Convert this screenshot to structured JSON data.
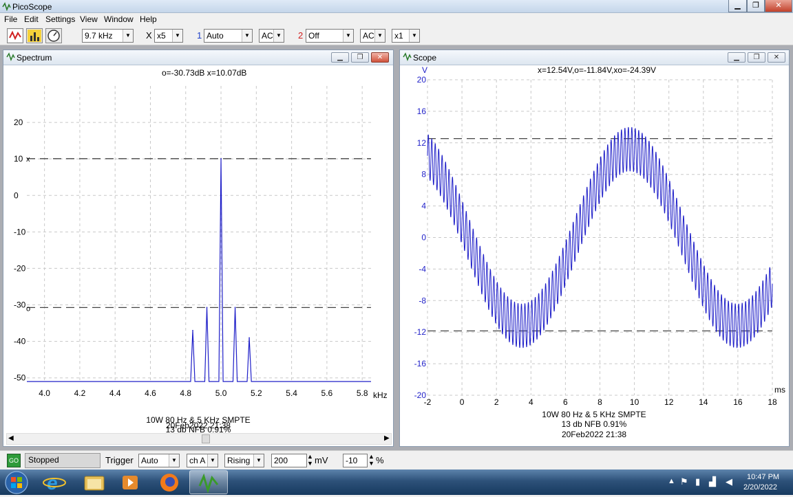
{
  "window": {
    "title": "PicoScope"
  },
  "menu": [
    "File",
    "Edit",
    "Settings",
    "View",
    "Window",
    "Help"
  ],
  "toolbar": {
    "timebase": "9.7 kHz",
    "mult_symbol": "X",
    "multiplier": "x5",
    "ch1_num": "1",
    "ch1_range": "Auto",
    "ch1_coupling": "AC",
    "ch2_num": "2",
    "ch2_range": "Off",
    "ch2_coupling": "AC",
    "ch2_mult": "x1"
  },
  "spectrum": {
    "title": "Spectrum",
    "readout": "o=-30.73dB  x=10.07dB",
    "xunit": "kHz",
    "caption": [
      "10W 80 Hz & 5 KHz SMPTE",
      "13 db NFB 0.91%",
      "20Feb2022  21:38"
    ],
    "marker_x": "x",
    "marker_o": "o"
  },
  "scope": {
    "title": "Scope",
    "yunit": "V",
    "readout": "x=12.54V,o=-11.84V,xo=-24.39V",
    "xunit": "ms",
    "caption": [
      "10W 80 Hz & 5 KHz SMPTE",
      "13 db NFB 0.91%",
      "20Feb2022  21:38"
    ]
  },
  "chart_data": [
    {
      "type": "line",
      "name": "spectrum",
      "xlabel": "kHz",
      "ylabel": "",
      "xlim": [
        3.9,
        5.85
      ],
      "ylim": [
        -51,
        30
      ],
      "xticks": [
        4.0,
        4.2,
        4.4,
        4.6,
        4.8,
        5.0,
        5.2,
        5.4,
        5.6,
        5.8
      ],
      "yticks": [
        20,
        10,
        0,
        -10,
        -20,
        -30,
        -40,
        -50
      ],
      "peaks": [
        {
          "x": 4.84,
          "y": -37
        },
        {
          "x": 4.92,
          "y": -30.7
        },
        {
          "x": 5.0,
          "y": 10.07
        },
        {
          "x": 5.08,
          "y": -30.7
        },
        {
          "x": 5.16,
          "y": -39
        }
      ],
      "floor": -51,
      "markers": {
        "x": 10.07,
        "o": -30.73
      },
      "color": "#1e1ec8"
    },
    {
      "type": "line",
      "name": "scope",
      "xlabel": "ms",
      "ylabel": "V",
      "xlim": [
        -2,
        18
      ],
      "ylim": [
        -20,
        20
      ],
      "xticks": [
        -2,
        0,
        2,
        4,
        6,
        8,
        10,
        12,
        14,
        16,
        18
      ],
      "yticks": [
        20,
        16,
        12,
        8,
        4,
        0,
        -4,
        -8,
        -12,
        -16,
        -20
      ],
      "signal": {
        "low_freq_hz": 80,
        "low_amp_v": 11.2,
        "high_freq_hz": 5000,
        "high_amp_v": 2.8,
        "phase_deg": 170
      },
      "markers": {
        "x": 12.54,
        "o": -11.84
      },
      "color": "#1e1ec8"
    }
  ],
  "statusbar": {
    "go": "GO",
    "state": "Stopped",
    "trigger_label": "Trigger",
    "trigger_mode": "Auto",
    "trigger_channel": "ch A",
    "trigger_edge": "Rising",
    "trigger_level": "200",
    "level_unit": "mV",
    "pretrigger": "-10",
    "pre_unit": "%"
  },
  "taskbar": {
    "time": "10:47 PM",
    "date": "2/20/2022"
  }
}
